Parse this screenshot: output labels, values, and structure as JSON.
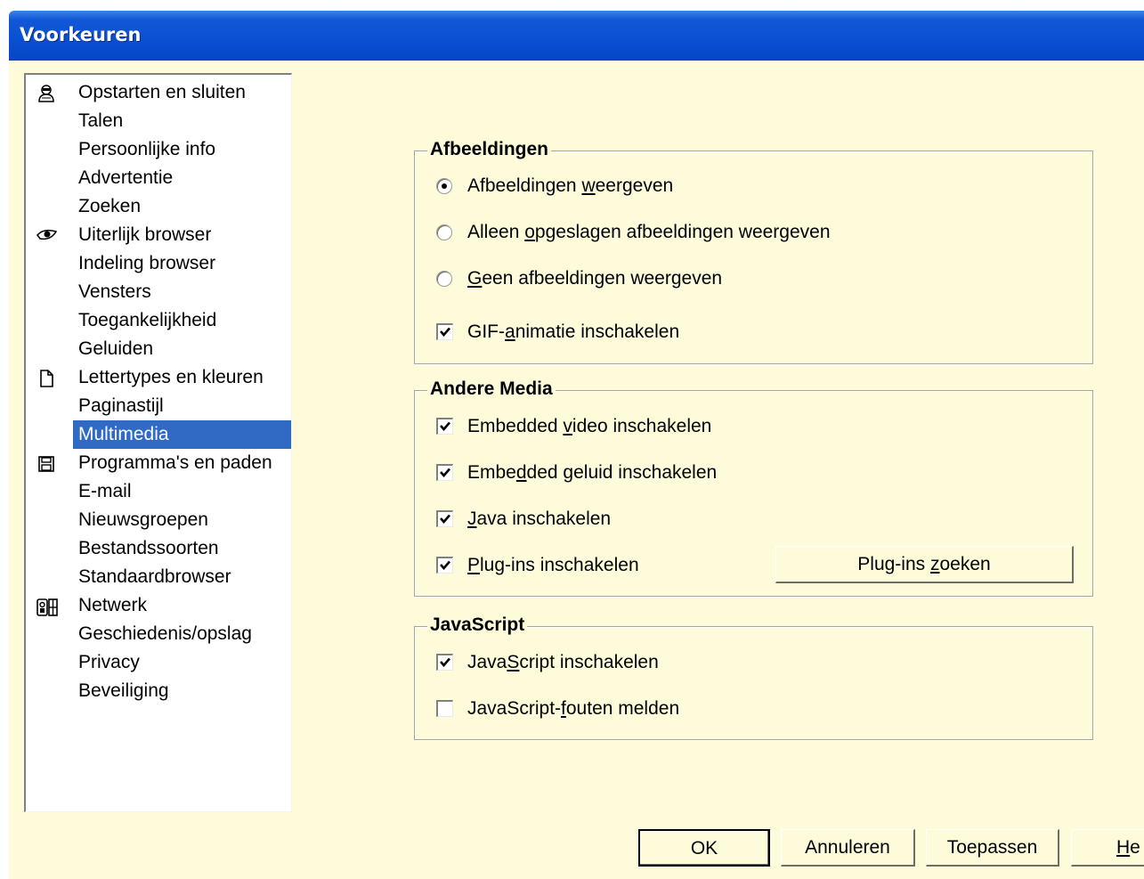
{
  "window": {
    "title": "Voorkeuren"
  },
  "sidebar": {
    "items": [
      {
        "label": "Opstarten en sluiten",
        "icon": "user-icon"
      },
      {
        "label": "Talen"
      },
      {
        "label": "Persoonlijke info"
      },
      {
        "label": "Advertentie"
      },
      {
        "label": "Zoeken"
      },
      {
        "label": "Uiterlijk browser",
        "icon": "eye-icon"
      },
      {
        "label": "Indeling browser"
      },
      {
        "label": "Vensters"
      },
      {
        "label": "Toegankelijkheid"
      },
      {
        "label": "Geluiden"
      },
      {
        "label": "Lettertypes en kleuren",
        "icon": "document-icon"
      },
      {
        "label": "Paginastijl"
      },
      {
        "label": "Multimedia",
        "selected": true
      },
      {
        "label": "Programma's en paden",
        "icon": "floppy-disk-icon"
      },
      {
        "label": "E-mail"
      },
      {
        "label": "Nieuwsgroepen"
      },
      {
        "label": "Bestandssoorten"
      },
      {
        "label": "Standaardbrowser"
      },
      {
        "label": "Netwerk",
        "icon": "network-icon"
      },
      {
        "label": "Geschiedenis/opslag"
      },
      {
        "label": "Privacy"
      },
      {
        "label": "Beveiliging"
      }
    ]
  },
  "images": {
    "title": "Afbeeldingen",
    "options": [
      {
        "pre": "Afbeeldingen ",
        "key": "w",
        "post": "eergeven",
        "checked": true
      },
      {
        "pre": "Alleen ",
        "key": "o",
        "post": "pgeslagen afbeeldingen weergeven",
        "checked": false
      },
      {
        "pre": "",
        "key": "G",
        "post": "een afbeeldingen weergeven",
        "checked": false
      }
    ],
    "gif": {
      "pre": "GIF-",
      "key": "a",
      "post": "nimatie inschakelen",
      "checked": true
    }
  },
  "media": {
    "title": "Andere Media",
    "video": {
      "pre": "Embedded ",
      "key": "v",
      "post": "ideo inschakelen",
      "checked": true
    },
    "sound": {
      "pre": "Embe",
      "key": "d",
      "post": "ded geluid inschakelen",
      "checked": true
    },
    "java": {
      "pre": "",
      "key": "J",
      "post": "ava inschakelen",
      "checked": true
    },
    "plugins": {
      "pre": "",
      "key": "P",
      "post": "lug-ins inschakelen",
      "checked": true
    },
    "find_plugins": {
      "pre": "Plug-ins ",
      "key": "z",
      "post": "oeken"
    }
  },
  "javascript": {
    "title": "JavaScript",
    "enable": {
      "pre": "Java",
      "key": "S",
      "post": "cript inschakelen",
      "checked": true
    },
    "errors": {
      "pre": "JavaScript-",
      "key": "f",
      "post": "outen melden",
      "checked": false
    }
  },
  "buttons": {
    "ok": "OK",
    "cancel": "Annuleren",
    "apply": "Toepassen",
    "help_key": "H",
    "help_post": "e"
  },
  "colors": {
    "titlebar": "#0a4fd2",
    "panel": "#fdfbd9",
    "selection": "#316ac5"
  }
}
